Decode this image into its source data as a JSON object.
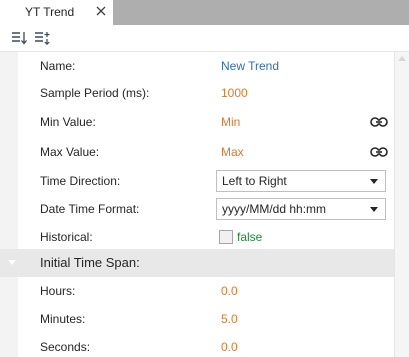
{
  "tab": {
    "title": "YT Trend",
    "close_glyph": "✕"
  },
  "toolbar": {
    "sort_icon": "sort-descending-icon",
    "category_icon": "categorized-list-icon"
  },
  "properties": [
    {
      "label": "Name:",
      "value": "New Trend",
      "value_color": "#2f6eb5"
    },
    {
      "label": "Sample Period (ms):",
      "value": "1000",
      "value_color": "#e07a2f"
    },
    {
      "label": "Min Value:",
      "value": "Min",
      "value_color": "#e07a2f",
      "icon": "link-icon"
    },
    {
      "label": "Max Value:",
      "value": "Max",
      "value_color": "#e07a2f",
      "icon": "link-icon"
    },
    {
      "label": "Time Direction:",
      "value": "Left to Right",
      "control": "dropdown"
    },
    {
      "label": "Date Time Format:",
      "value": "yyyy/MM/dd hh:mm",
      "control": "dropdown"
    },
    {
      "label": "Historical:",
      "value": "false",
      "checked": false,
      "control": "checkbox"
    }
  ],
  "section": {
    "title": "Initial Time Span:",
    "rows": [
      {
        "label": "Hours:",
        "value": "0.0"
      },
      {
        "label": "Minutes:",
        "value": "5.0"
      },
      {
        "label": "Seconds:",
        "value": "0.0"
      }
    ]
  }
}
